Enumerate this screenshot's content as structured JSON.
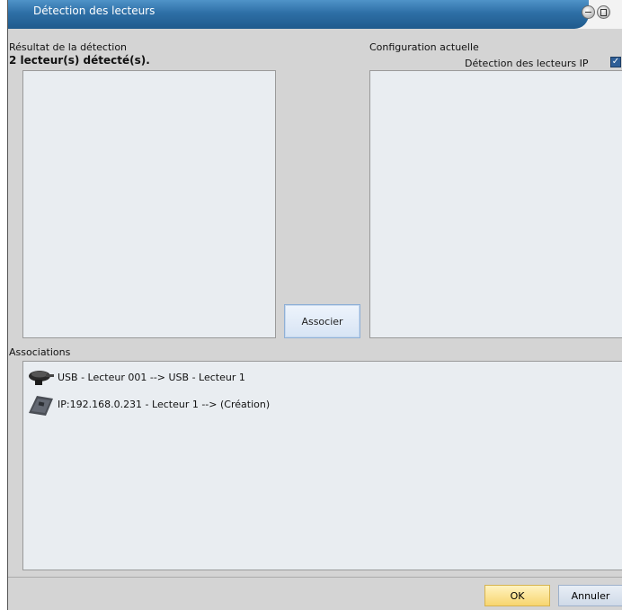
{
  "window": {
    "title": "Détection des lecteurs"
  },
  "detection": {
    "section_label": "Résultat de la détection",
    "count_text": "2 lecteur(s) détecté(s)."
  },
  "config": {
    "section_label": "Configuration actuelle",
    "ip_detection_label": "Détection des lecteurs IP",
    "ip_detection_checked": true
  },
  "associate_button": "Associer",
  "associations": {
    "label": "Associations",
    "items": [
      {
        "icon": "usb-reader-icon",
        "text": "USB - Lecteur 001 --> USB - Lecteur 1"
      },
      {
        "icon": "ip-reader-icon",
        "text": "IP:192.168.0.231 - Lecteur 1 --> (Création)"
      }
    ]
  },
  "footer": {
    "ok_label": "OK",
    "cancel_label": "Annuler"
  },
  "colors": {
    "title_bar": "#2e6fa6",
    "panel_bg": "#e9edf1",
    "ok_accent": "#f7d56f"
  }
}
